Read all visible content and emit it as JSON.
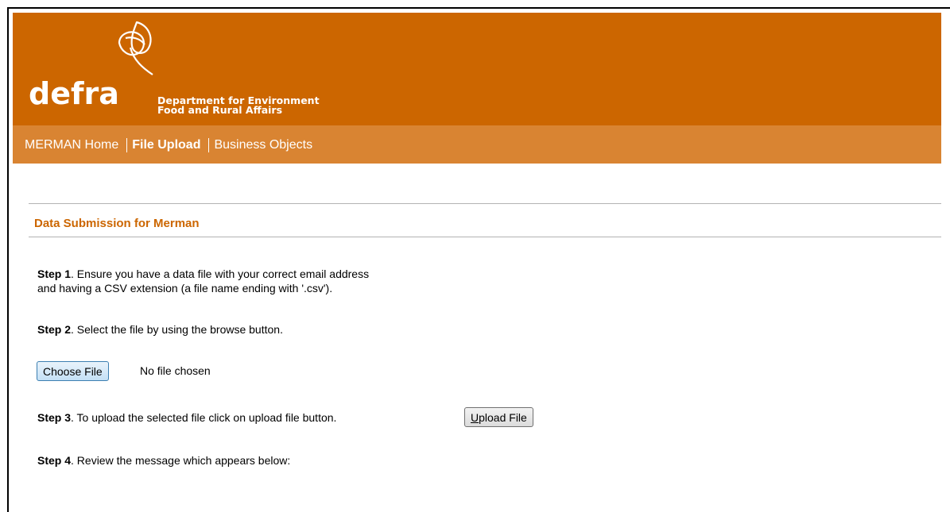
{
  "header": {
    "logo_word": "defra",
    "dept_line1": "Department for Environment",
    "dept_line2": "Food and Rural Affairs",
    "banner_color": "#cc6600",
    "nav_color": "#d98432"
  },
  "nav": {
    "items": [
      {
        "label": "MERMAN Home"
      },
      {
        "label": "File Upload"
      },
      {
        "label": "Business Objects"
      }
    ]
  },
  "main": {
    "section_title": "Data Submission for Merman",
    "step1": {
      "label": "Step 1",
      "line1": ". Ensure you have a data file with your correct email address",
      "line2": "and having a CSV extension (a file name ending with '.csv')."
    },
    "step2": {
      "label": "Step 2",
      "text": ". Select the file by using the browse button."
    },
    "file_input": {
      "button_label": "Choose File",
      "status": "No file chosen"
    },
    "step3": {
      "label": "Step 3",
      "text": ". To upload the selected file click on upload file button."
    },
    "upload_button": {
      "accel": "U",
      "rest": "pload File"
    },
    "step4": {
      "label": "Step 4",
      "text": ". Review the message which appears below:"
    }
  }
}
